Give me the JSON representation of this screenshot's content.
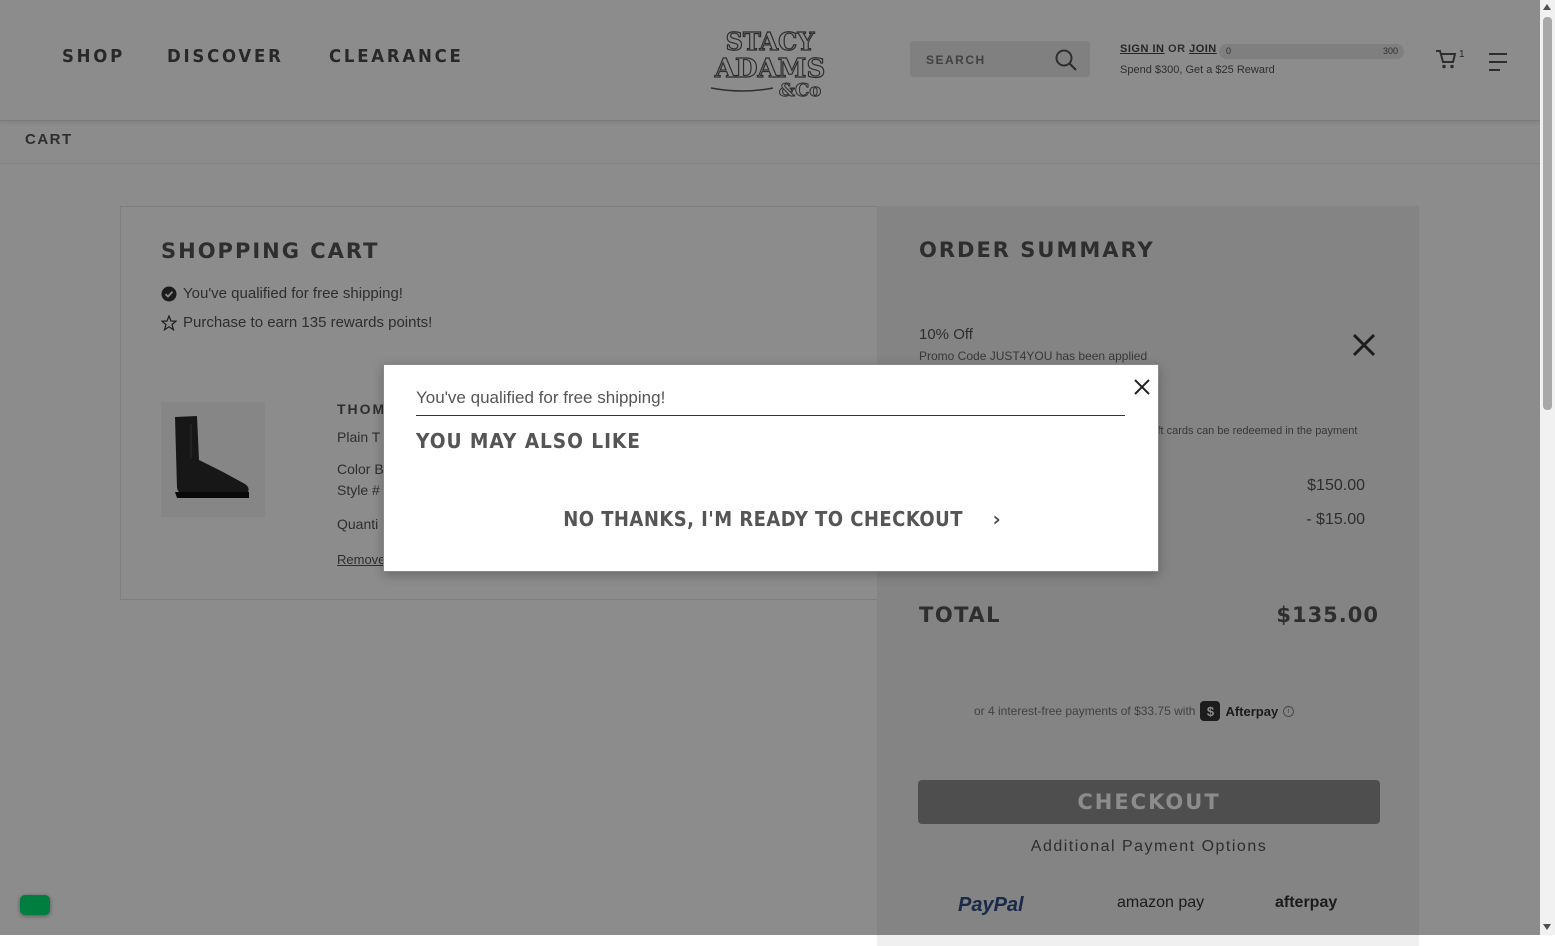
{
  "header": {
    "nav": [
      "SHOP",
      "DISCOVER",
      "CLEARANCE"
    ],
    "logo_text": "STACY ADAMS & Co",
    "search_placeholder": "SEARCH",
    "sign_in": "SIGN IN",
    "or": "OR",
    "join": "JOIN",
    "progress_min": "0",
    "progress_max": "300",
    "progress_value": 0,
    "reward_msg": "Spend $300, Get a $25 Reward",
    "cart_count": "1"
  },
  "breadcrumb": "CART",
  "cart": {
    "title": "SHOPPING CART",
    "free_shipping": "You've qualified for free shipping!",
    "rewards": "Purchase to earn 135 rewards points!",
    "product_name": "THOMP",
    "product_line1": "Plain T",
    "color_label": "Color B",
    "style_label": "Style #",
    "quantity_label": "Quanti",
    "remove_label": "Remove"
  },
  "summary": {
    "title": "ORDER SUMMARY",
    "promo_title": "10% Off",
    "promo_detail": "Promo Code JUST4YOU has been applied",
    "gift_note": "ift cards can be redeemed in the payment",
    "subtotal": "$150.00",
    "discount": "- $15.00",
    "total_label": "TOTAL",
    "total_value": "$135.00",
    "afterpay_text": "or 4 interest-free payments of $33.75 with",
    "afterpay_badge": "$",
    "afterpay_name": "Afterpay",
    "afterpay_info": "i",
    "checkout_label": "CHECKOUT",
    "additional_payment": "Additional Payment Options",
    "payment_options": [
      "PayPal",
      "amazon pay",
      "afterpay"
    ]
  },
  "modal": {
    "shipping_msg": "You've qualified for free shipping!",
    "title": "YOU MAY ALSO LIKE",
    "cta": "NO THANKS, I'M READY TO CHECKOUT",
    "cta_arrow": "›"
  },
  "colors": {
    "overlay": "#000000",
    "chat_badge": "#00e676",
    "checkout_button": "#8f8f8f"
  }
}
